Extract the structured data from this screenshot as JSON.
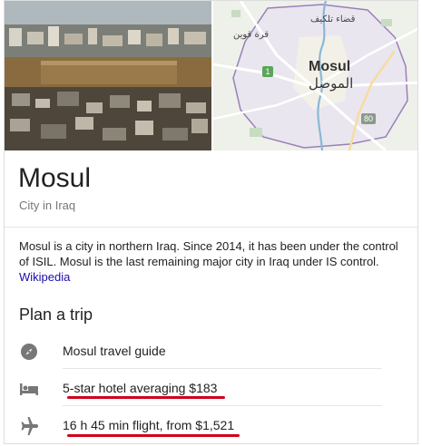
{
  "place": {
    "name": "Mosul",
    "type": "City in Iraq",
    "description": "Mosul is a city in northern Iraq. Since 2014, it has been under the control of ISIL. Mosul is the last remaining major city in Iraq under IS control.",
    "source_link": "Wikipedia"
  },
  "map": {
    "label_en": "Mosul",
    "label_ar": "الموصل",
    "district_1": "قضاء تلكيف",
    "district_2": "قرة قوين",
    "road_1": "1",
    "road_80": "80"
  },
  "plan": {
    "title": "Plan a trip",
    "items": [
      {
        "icon": "compass-icon",
        "label": "Mosul travel guide"
      },
      {
        "icon": "bed-icon",
        "label": "5-star hotel averaging $183"
      },
      {
        "icon": "airplane-icon",
        "label": "16 h 45 min flight, from $1,521"
      }
    ]
  },
  "colors": {
    "link": "#1a0dab",
    "annotation_underline": "#d0021b",
    "icon_gray": "#777777"
  }
}
